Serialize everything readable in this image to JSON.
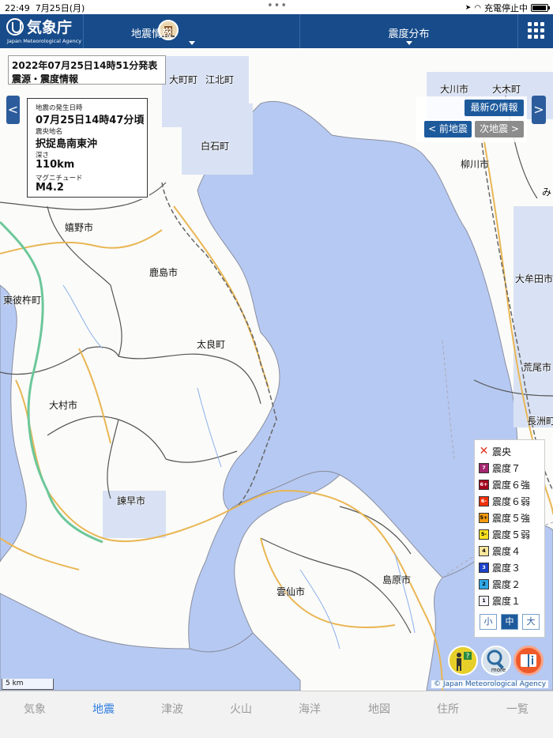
{
  "status_bar": {
    "time": "22:49",
    "date": "7月25日(月)",
    "charging": "充電停止中",
    "battery_level": 0.95
  },
  "header": {
    "logo_title": "気象庁",
    "logo_subtitle": "Japan Meteorological Agency",
    "tab_earthquake": "地震情報",
    "tab_intensity": "震度分布"
  },
  "banner": {
    "issued": "2022年07月25日14時51分発表",
    "title": "震源・震度情報"
  },
  "quake": {
    "time_label": "地震の発生日時",
    "time_value": "07月25日14時47分頃",
    "epicenter_label": "震央地名",
    "epicenter_value": "択捉島南東沖",
    "depth_label": "深さ",
    "depth_value": "110km",
    "magnitude_label": "マグニチュード",
    "magnitude_value": "M4.2"
  },
  "nav": {
    "latest": "最新の情報",
    "prev": "< 前地震",
    "next": "次地震 >",
    "arrow_left": "<",
    "arrow_right": ">"
  },
  "places": {
    "omachi": "大町町",
    "kohoku": "江北町",
    "okawa": "大川市",
    "okimachi": "大木町",
    "shiroishi": "白石町",
    "yanagawa": "柳川市",
    "ureshino": "嬉野市",
    "kashima": "鹿島市",
    "omuta": "大牟田市",
    "higashisonogi": "東彼杵町",
    "tara": "太良町",
    "omura": "大村市",
    "arao": "荒尾市",
    "nagasu": "長洲町",
    "isahaya": "諫早市",
    "unzen": "雲仙市",
    "shimabara": "島原市",
    "miyama": "み"
  },
  "legend": {
    "epicenter": "震央",
    "items": [
      {
        "badge": "7",
        "label": "震度７",
        "color": "#a3256d",
        "text": "#ffffff"
      },
      {
        "badge": "6+",
        "label": "震度６強",
        "color": "#a5021c",
        "text": "#ffffff"
      },
      {
        "badge": "6-",
        "label": "震度６弱",
        "color": "#f0300a",
        "text": "#ffffff"
      },
      {
        "badge": "5+",
        "label": "震度５強",
        "color": "#f29a0c",
        "text": "#000000"
      },
      {
        "badge": "5-",
        "label": "震度５弱",
        "color": "#f9e21e",
        "text": "#000000"
      },
      {
        "badge": "4",
        "label": "震度４",
        "color": "#fae69b",
        "text": "#000000"
      },
      {
        "badge": "3",
        "label": "震度３",
        "color": "#1b41c9",
        "text": "#ffffff"
      },
      {
        "badge": "2",
        "label": "震度２",
        "color": "#2fa7e6",
        "text": "#000000"
      },
      {
        "badge": "1",
        "label": "震度１",
        "color": "#f2f2ff",
        "text": "#000000"
      }
    ],
    "size_small": "小",
    "size_medium": "中",
    "size_large": "大"
  },
  "map": {
    "scale": "5 km",
    "attribution": "© Japan Meteorological Agency",
    "sea_color": "#b6c9f2",
    "land_color": "#fbfbf9"
  },
  "tabbar": [
    "気象",
    "地震",
    "津波",
    "火山",
    "海洋",
    "地図",
    "住所",
    "一覧"
  ]
}
